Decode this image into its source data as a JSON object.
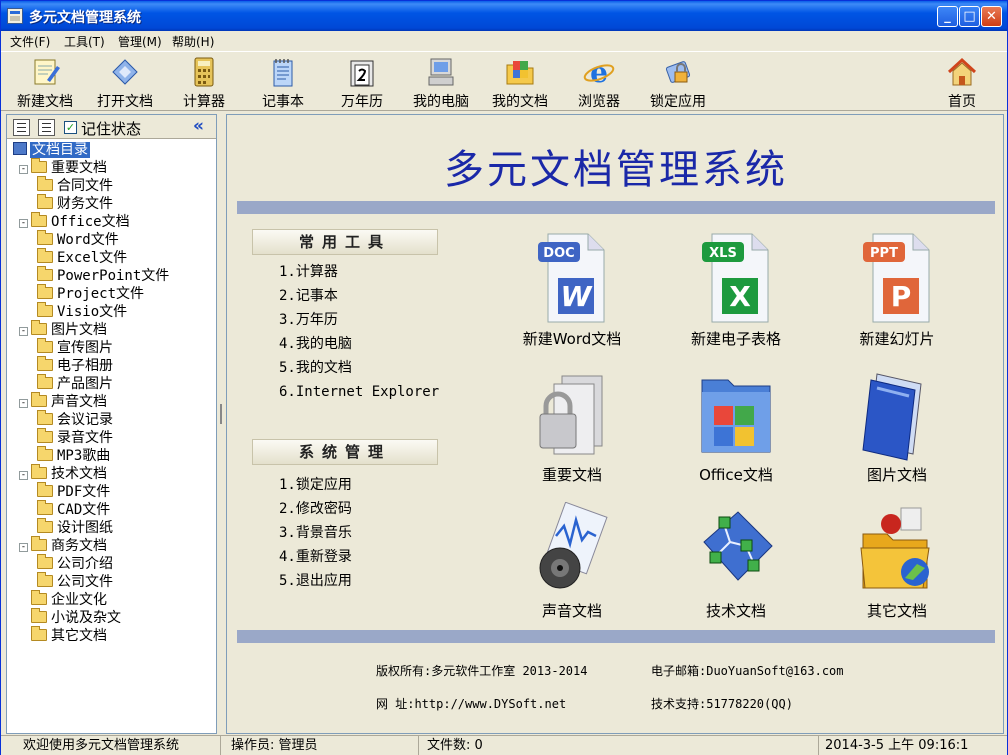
{
  "window": {
    "title": "多元文档管理系统",
    "min": "_",
    "max": "□",
    "close": "✕"
  },
  "menu": [
    "文件(F)",
    "工具(T)",
    "管理(M)",
    "帮助(H)"
  ],
  "toolbar": [
    {
      "label": "新建文档",
      "icon": "new-doc-icon"
    },
    {
      "label": "打开文档",
      "icon": "open-doc-icon"
    },
    {
      "label": "计算器",
      "icon": "calculator-icon"
    },
    {
      "label": "记事本",
      "icon": "notepad-icon"
    },
    {
      "label": "万年历",
      "icon": "calendar-icon"
    },
    {
      "label": "我的电脑",
      "icon": "computer-icon"
    },
    {
      "label": "我的文档",
      "icon": "my-documents-icon"
    },
    {
      "label": "浏览器",
      "icon": "browser-icon"
    },
    {
      "label": "锁定应用",
      "icon": "lock-app-icon"
    },
    {
      "label": "首页",
      "icon": "home-icon"
    }
  ],
  "panel": {
    "remember": "记住状态",
    "collapse": "«",
    "check": "✓"
  },
  "tree": [
    {
      "label": "文档目录",
      "level": 0,
      "root": true
    },
    {
      "label": "重要文档",
      "level": 1,
      "expand": "-"
    },
    {
      "label": "合同文件",
      "level": 2
    },
    {
      "label": "财务文件",
      "level": 2
    },
    {
      "label": "Office文档",
      "level": 1,
      "expand": "-"
    },
    {
      "label": "Word文件",
      "level": 2
    },
    {
      "label": "Excel文件",
      "level": 2
    },
    {
      "label": "PowerPoint文件",
      "level": 2
    },
    {
      "label": "Project文件",
      "level": 2
    },
    {
      "label": "Visio文件",
      "level": 2
    },
    {
      "label": "图片文档",
      "level": 1,
      "expand": "-"
    },
    {
      "label": "宣传图片",
      "level": 2
    },
    {
      "label": "电子相册",
      "level": 2
    },
    {
      "label": "产品图片",
      "level": 2
    },
    {
      "label": "声音文档",
      "level": 1,
      "expand": "-"
    },
    {
      "label": "会议记录",
      "level": 2
    },
    {
      "label": "录音文件",
      "level": 2
    },
    {
      "label": "MP3歌曲",
      "level": 2
    },
    {
      "label": "技术文档",
      "level": 1,
      "expand": "-"
    },
    {
      "label": "PDF文件",
      "level": 2
    },
    {
      "label": "CAD文件",
      "level": 2
    },
    {
      "label": "设计图纸",
      "level": 2
    },
    {
      "label": "商务文档",
      "level": 1,
      "expand": "-"
    },
    {
      "label": "公司介绍",
      "level": 2
    },
    {
      "label": "公司文件",
      "level": 2
    },
    {
      "label": "企业文化",
      "level": 1
    },
    {
      "label": "小说及杂文",
      "level": 1
    },
    {
      "label": "其它文档",
      "level": 1
    }
  ],
  "main": {
    "title": "多元文档管理系统",
    "tools_head": "常用工具",
    "tools": [
      "1.计算器",
      "2.记事本",
      "3.万年历",
      "4.我的电脑",
      "5.我的文档",
      "6.Internet Explorer"
    ],
    "sys_head": "系统管理",
    "sys": [
      "1.锁定应用",
      "2.修改密码",
      "3.背景音乐",
      "4.重新登录",
      "5.退出应用"
    ],
    "tiles": [
      {
        "label": "新建Word文档",
        "icon": "word-doc-icon",
        "badge": "DOC",
        "glyph": "W",
        "color": "#3f65c4"
      },
      {
        "label": "新建电子表格",
        "icon": "excel-sheet-icon",
        "badge": "XLS",
        "glyph": "X",
        "color": "#1d9a3e"
      },
      {
        "label": "新建幻灯片",
        "icon": "powerpoint-icon",
        "badge": "PPT",
        "glyph": "P",
        "color": "#e0663a"
      },
      {
        "label": "重要文档",
        "icon": "locked-folder-icon"
      },
      {
        "label": "Office文档",
        "icon": "office-folder-icon"
      },
      {
        "label": "图片文档",
        "icon": "picture-folder-icon"
      },
      {
        "label": "声音文档",
        "icon": "sound-icon"
      },
      {
        "label": "技术文档",
        "icon": "network-diagram-icon"
      },
      {
        "label": "其它文档",
        "icon": "other-folder-icon"
      }
    ],
    "footer": {
      "copyright": "版权所有:多元软件工作室 2013-2014",
      "email": "电子邮箱:DuoYuanSoft@163.com",
      "web": "网    址:http://www.DYSoft.net",
      "support": "技术支持:51778220(QQ)"
    }
  },
  "status": {
    "welcome": "欢迎使用多元文档管理系统",
    "operator": "操作员: 管理员",
    "filecount": "文件数: 0",
    "datetime": "2014-3-5 上午 09:16:1"
  }
}
